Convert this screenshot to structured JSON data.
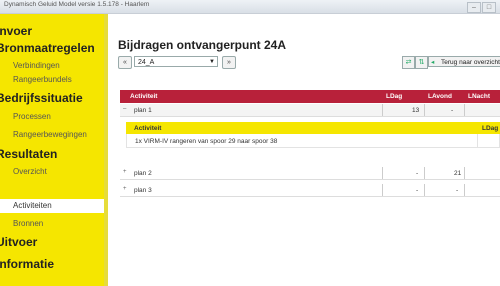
{
  "window": {
    "title": "Dynamisch Geluid Model versie 1.5.178 - Haarlem",
    "min": "–",
    "max": "□"
  },
  "sidebar": {
    "sections": [
      {
        "label": "Invoer"
      },
      {
        "label": "Bronmaatregelen"
      },
      {
        "label": "Bedrijfssituatie"
      },
      {
        "label": "Resultaten"
      },
      {
        "label": "Uitvoer"
      },
      {
        "label": "Informatie"
      }
    ],
    "items": [
      {
        "label": "Verbindingen"
      },
      {
        "label": "Rangeerbundels"
      },
      {
        "label": "Processen"
      },
      {
        "label": "Rangeerbewegingen"
      },
      {
        "label": "Overzicht"
      },
      {
        "label": "Activiteiten"
      },
      {
        "label": "Bronnen"
      }
    ]
  },
  "main": {
    "title": "Bijdragen ontvangerpunt 24A",
    "prev_label": "«",
    "next_label": "»",
    "select_value": "24_A",
    "back_label": "Terug naar overzicht"
  },
  "table": {
    "headers": {
      "activiteit": "Activiteit",
      "ldag": "LDag",
      "lavond": "LAvond",
      "lnacht": "LNacht"
    },
    "rows": [
      {
        "toggle": "–",
        "label": "plan 1",
        "ldag": "13",
        "lavond": "-"
      },
      {
        "toggle": "+",
        "label": "plan 2",
        "ldag": "-",
        "lavond": "21"
      },
      {
        "toggle": "+",
        "label": "plan 3",
        "ldag": "-",
        "lavond": "-"
      }
    ],
    "sub": {
      "headers": {
        "activiteit": "Activiteit",
        "ldag": "LDag"
      },
      "row": "1x VIRM-IV rangeren van spoor 29 naar spoor 38"
    }
  }
}
